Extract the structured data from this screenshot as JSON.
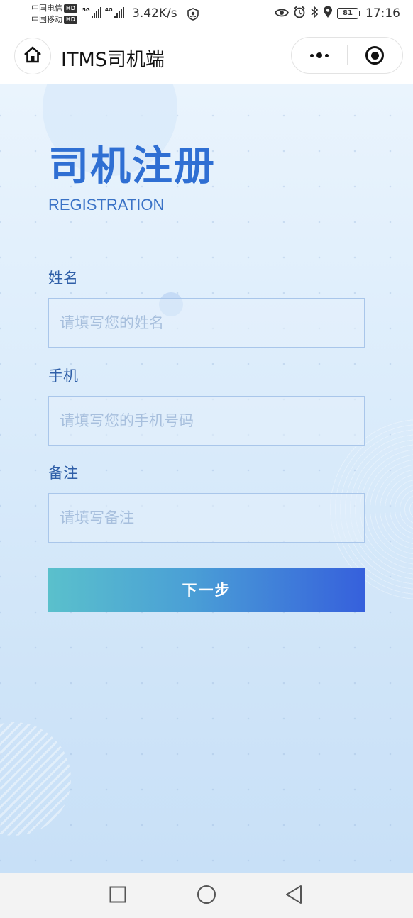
{
  "status_bar": {
    "carrier_1": "中国电信",
    "carrier_2": "中国移动",
    "hd_label": "HD",
    "signal_1_tag": "5G",
    "signal_2_tag": "4G",
    "net_speed": "3.42K/s",
    "battery_level": "81",
    "time": "17:16",
    "icons": [
      "shield-person-icon",
      "eye-icon",
      "alarm-icon",
      "bluetooth-icon",
      "location-icon",
      "battery-icon"
    ]
  },
  "nav": {
    "title": "ITMS司机端",
    "home_icon": "home-icon",
    "more_icon": "more-dots-icon",
    "close_icon": "target-close-icon"
  },
  "page": {
    "title": "司机注册",
    "subtitle": "REGISTRATION"
  },
  "form": {
    "name_label": "姓名",
    "name_placeholder": "请填写您的姓名",
    "name_value": "",
    "phone_label": "手机",
    "phone_placeholder": "请填写您的手机号码",
    "phone_value": "",
    "remark_label": "备注",
    "remark_placeholder": "请填写备注",
    "remark_value": "",
    "next_button": "下一步"
  },
  "system_nav": {
    "icons": [
      "recent-apps-icon",
      "home-circle-icon",
      "back-triangle-icon"
    ]
  },
  "colors": {
    "title_blue": "#2f6fd3",
    "button_gradient_start": "#5ac0cc",
    "button_gradient_end": "#3660dc",
    "input_border": "#a9c6ea"
  }
}
